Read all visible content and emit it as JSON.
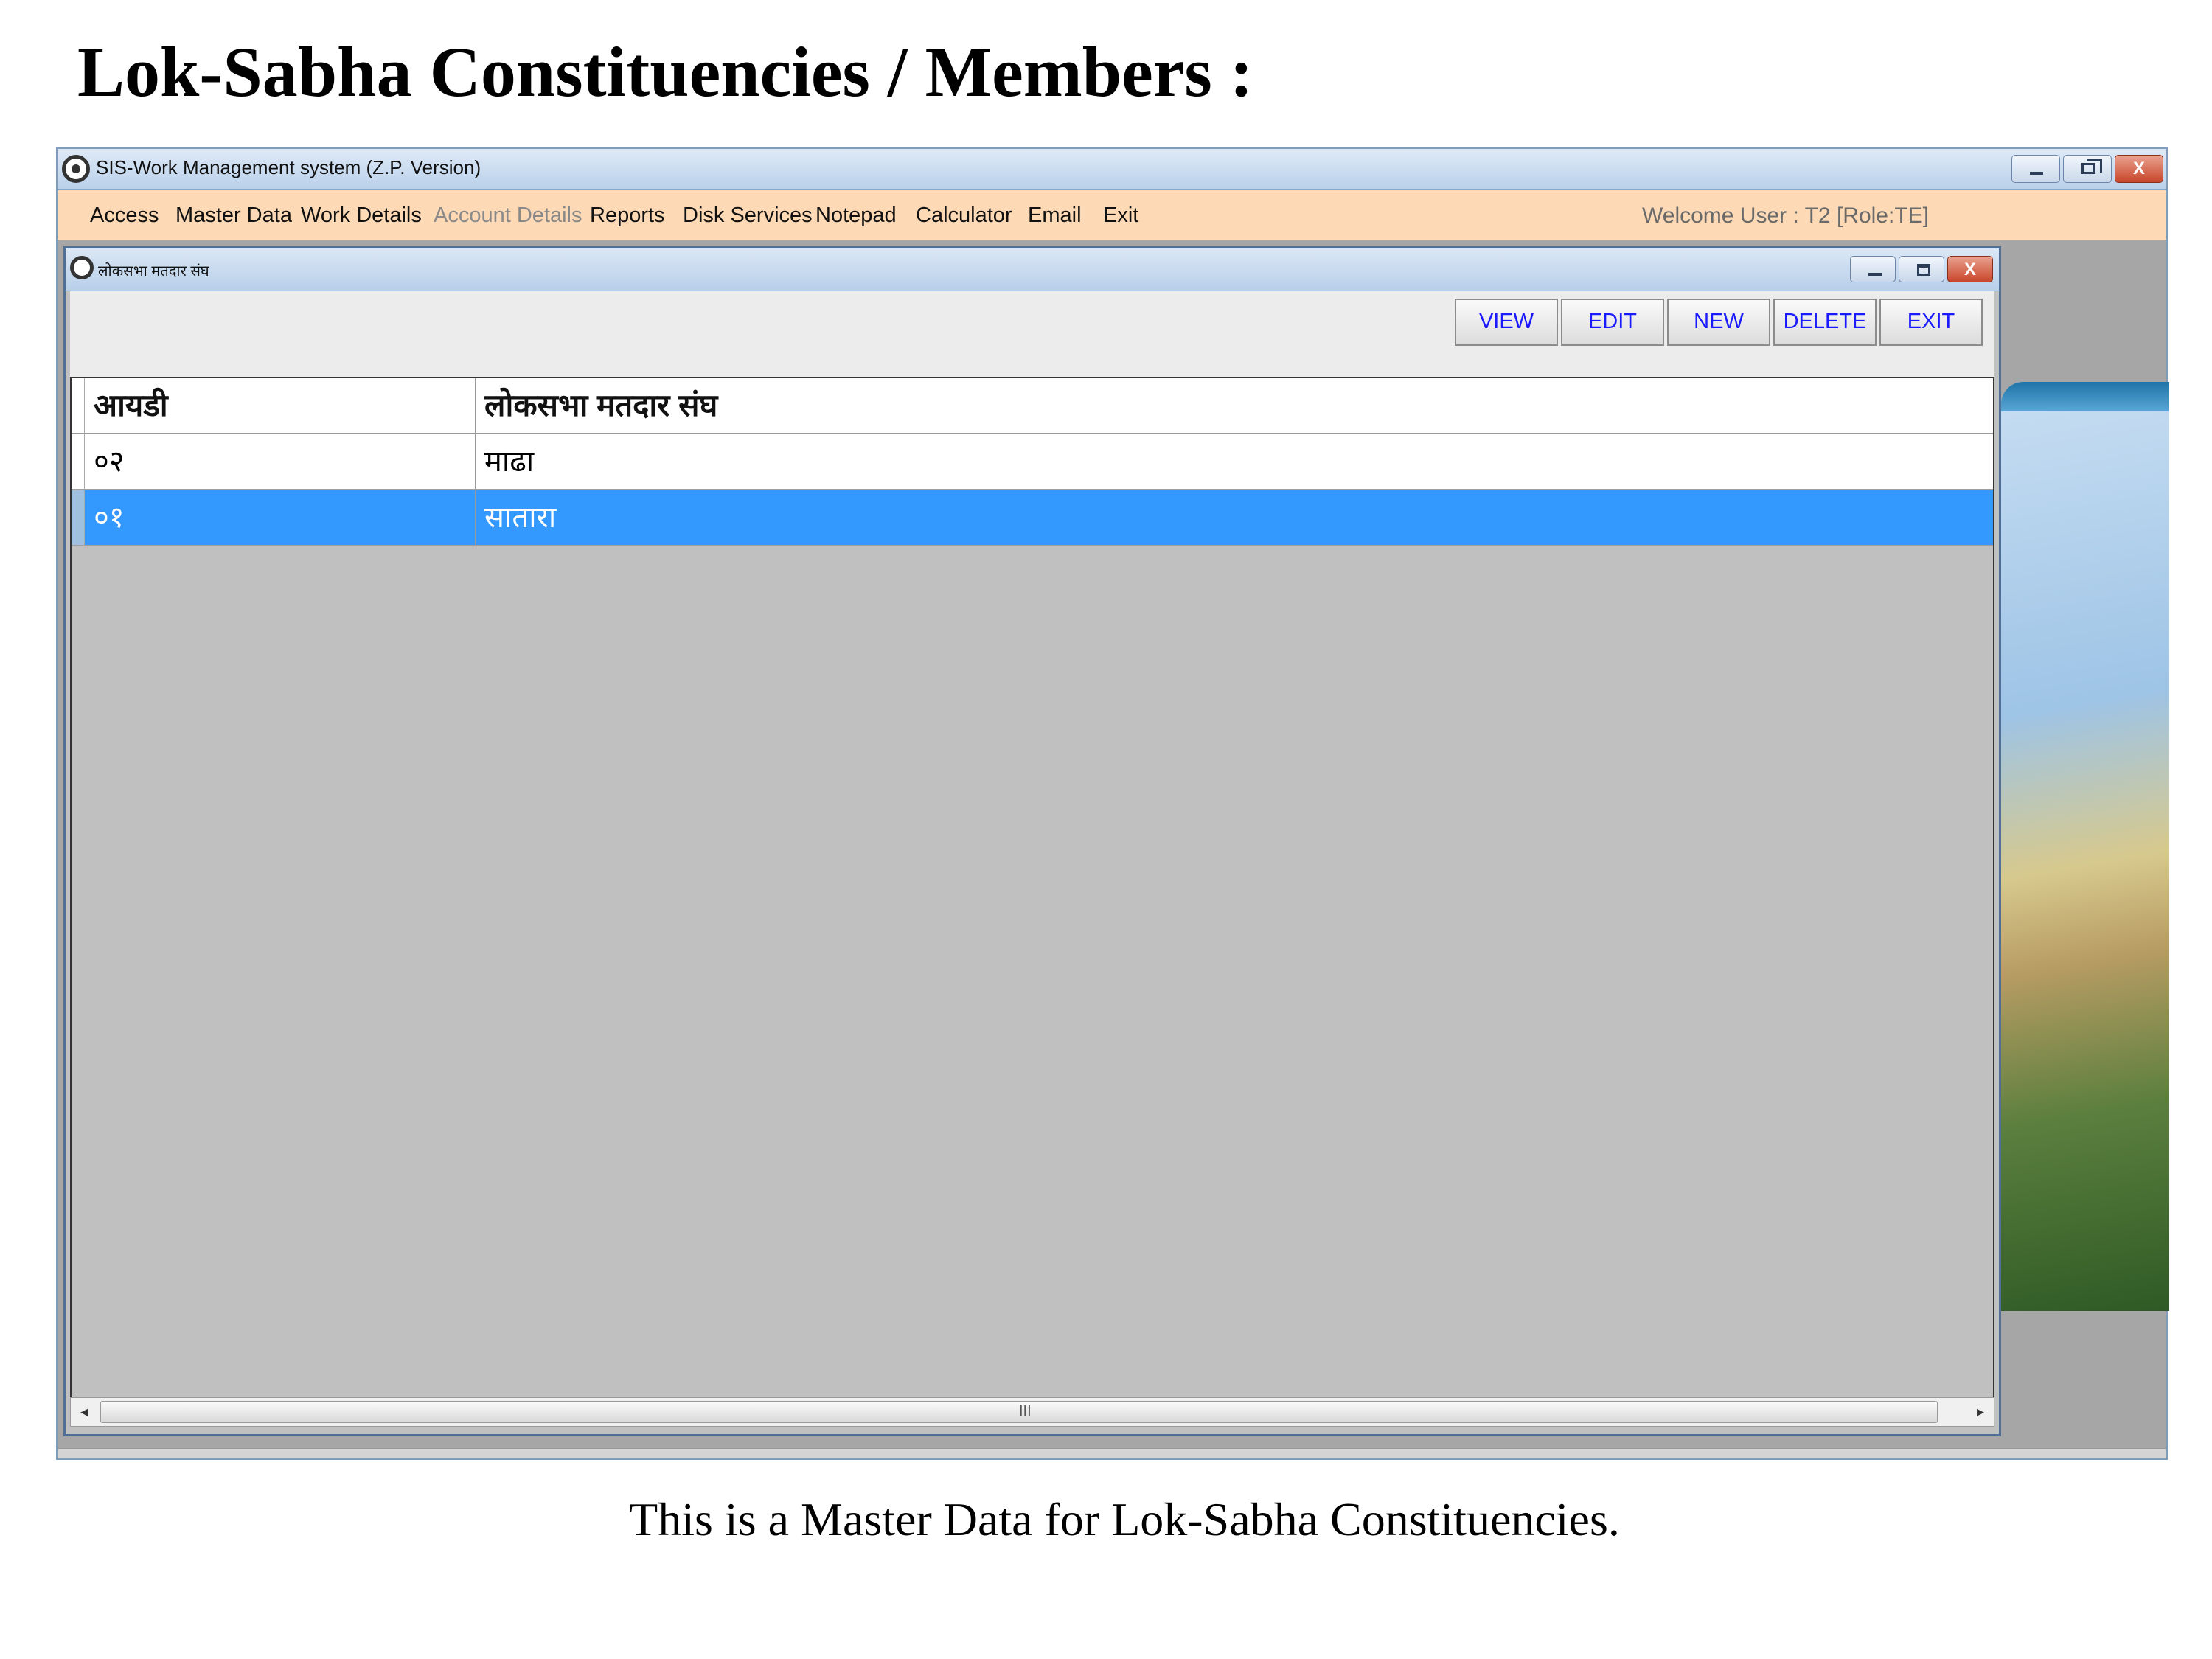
{
  "page": {
    "heading": "Lok-Sabha Constituencies / Members :",
    "caption": "This is a Master Data for Lok-Sabha Constituencies."
  },
  "app": {
    "title": "SIS-Work Management system (Z.P. Version)",
    "menu": [
      {
        "label": "Access",
        "enabled": true
      },
      {
        "label": "Master Data",
        "enabled": true
      },
      {
        "label": "Work Details",
        "enabled": true
      },
      {
        "label": "Account Details",
        "enabled": false
      },
      {
        "label": "Reports",
        "enabled": true
      },
      {
        "label": "Disk Services",
        "enabled": true
      },
      {
        "label": "Notepad",
        "enabled": true
      },
      {
        "label": "Calculator",
        "enabled": true
      },
      {
        "label": "Email",
        "enabled": true
      },
      {
        "label": "Exit",
        "enabled": true
      }
    ],
    "welcome": "Welcome User : T2 [Role:TE]",
    "close_glyph": "X"
  },
  "child": {
    "title": "लोकसभा मतदार संघ",
    "close_glyph": "X",
    "buttons": [
      "VIEW",
      "EDIT",
      "NEW",
      "DELETE",
      "EXIT"
    ],
    "grid": {
      "columns": [
        "आयडी",
        "लोकसभा मतदार संघ"
      ],
      "rows": [
        {
          "id": "०२",
          "name": "माढा",
          "selected": false
        },
        {
          "id": "०१",
          "name": "सातारा",
          "selected": true
        }
      ]
    },
    "scrollbar_grip": "III"
  }
}
